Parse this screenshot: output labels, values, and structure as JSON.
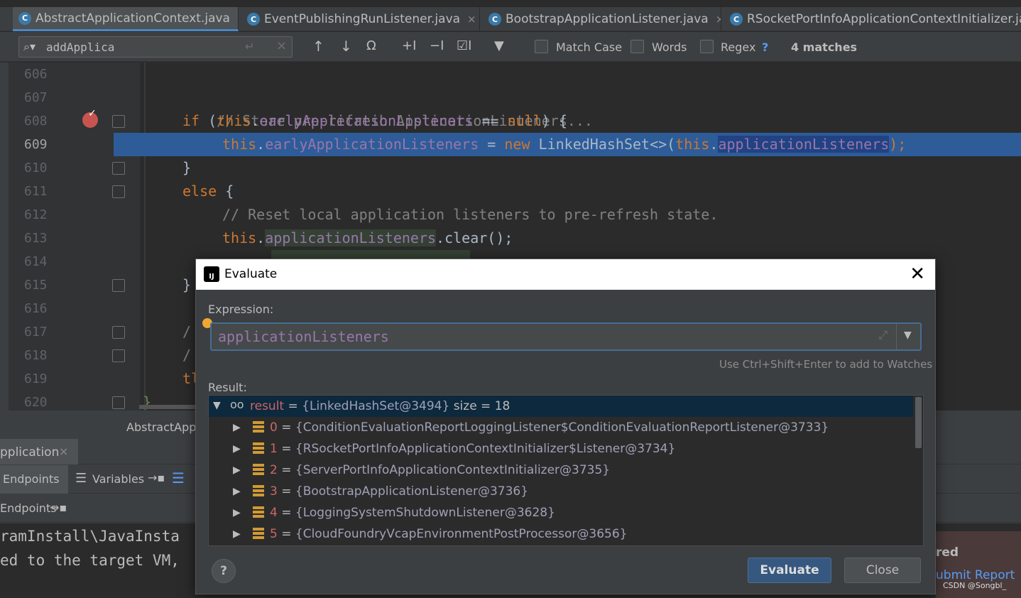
{
  "tabs": [
    {
      "label": "AbstractApplicationContext.java",
      "active": true
    },
    {
      "label": "EventPublishingRunListener.java",
      "active": false
    },
    {
      "label": "BootstrapApplicationListener.java",
      "active": false
    },
    {
      "label": "RSocketPortInfoApplicationContextInitializer.java",
      "active": false
    }
  ],
  "find": {
    "query": "addApplica",
    "match_case": "Match Case",
    "words": "Words",
    "regex": "Regex",
    "help": "?",
    "matches": "4 matches"
  },
  "editor": {
    "line_numbers": [
      "606",
      "607",
      "608",
      "609",
      "610",
      "611",
      "612",
      "613",
      "614",
      "615",
      "616",
      "617",
      "618",
      "619",
      "620"
    ],
    "lines": {
      "l607_comment": "// Store pre-refresh ApplicationListeners...",
      "l608_if": "if",
      "l608_paren": " (",
      "l608_this": "this",
      "l608_dot": ".",
      "l608_field": "earlyApplicationListeners",
      "l608_eq": " == ",
      "l608_null": "null",
      "l608_close": ") {",
      "l609_this": "this",
      "l609_dot": ".",
      "l609_field": "earlyApplicationListeners",
      "l609_assign": " = ",
      "l609_new": "new",
      "l609_type": " LinkedHashSet<>(",
      "l609_this2": "this",
      "l609_dot2": ".",
      "l609_field2": "applicationListeners",
      "l609_end": ");",
      "l610_brace": "}",
      "l611_else": "else",
      "l611_brace": " {",
      "l612_comment": "// Reset local application listeners to pre-refresh state.",
      "l613_this": "this",
      "l613_dot": ".",
      "l613_field": "applicationListeners",
      "l613_call": ".clear();",
      "l615_brace": "}",
      "l617_frag": "/",
      "l618_frag": "/",
      "l619_frag": "tl",
      "l620_brace": "}"
    },
    "breadcrumb": "AbstractApp"
  },
  "bottom": {
    "run_tab": "pplication",
    "endpoints_tab": "Endpoints",
    "variables_tab": "Variables",
    "endpoints_sub": "Endpoints",
    "console_line1": "ramInstall\\JavaInsta",
    "console_line2": "ed to the target VM,",
    "notify_title": "red",
    "notify_link": "ubmit Report",
    "watermark": "CSDN @Songbl_"
  },
  "dialog": {
    "title": "Evaluate",
    "expression_label": "Expression:",
    "expression_value": "applicationListeners",
    "hint": "Use Ctrl+Shift+Enter to add to Watches",
    "result_label": "Result:",
    "result_root": {
      "name": "result",
      "eq": " = ",
      "value": "{LinkedHashSet@3494}",
      "size": "size = 18"
    },
    "items": [
      {
        "index": "0",
        "value": "{ConditionEvaluationReportLoggingListener$ConditionEvaluationReportListener@3733}"
      },
      {
        "index": "1",
        "value": "{RSocketPortInfoApplicationContextInitializer$Listener@3734}"
      },
      {
        "index": "2",
        "value": "{ServerPortInfoApplicationContextInitializer@3735}"
      },
      {
        "index": "3",
        "value": "{BootstrapApplicationListener@3736}"
      },
      {
        "index": "4",
        "value": "{LoggingSystemShutdownListener@3628}"
      },
      {
        "index": "5",
        "value": "{CloudFoundryVcapEnvironmentPostProcessor@3656}"
      }
    ],
    "help_button": "?",
    "evaluate_button": "Evaluate",
    "close_button": "Close"
  }
}
